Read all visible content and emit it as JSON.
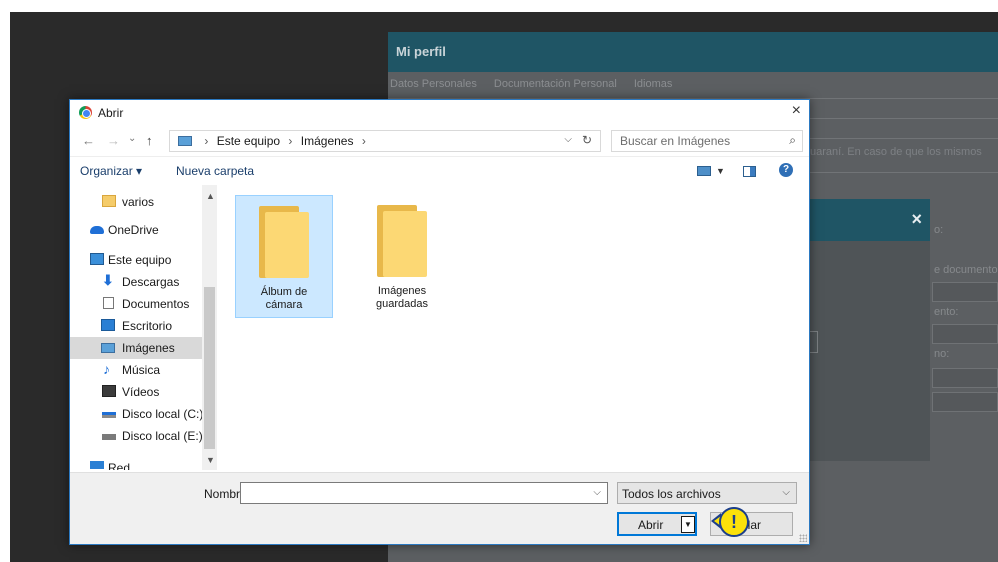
{
  "background_page": {
    "title": "Mi perfil",
    "tabs": [
      "Datos Personales",
      "Documentación Personal",
      "Idiomas"
    ],
    "notice_fragment": "uaraní. En caso de que los mismos",
    "right_labels": [
      "o:",
      "e documento",
      "ento:",
      "no:"
    ],
    "modal_close": "×"
  },
  "dialog": {
    "title": "Abrir",
    "close": "×",
    "nav": {
      "back": "←",
      "forward": "→",
      "recent": "⌄",
      "up": "↑"
    },
    "breadcrumb": [
      "Este equipo",
      "Imágenes"
    ],
    "search_placeholder": "Buscar en Imágenes",
    "toolbar": {
      "organize": "Organizar ▾",
      "new_folder": "Nueva carpeta",
      "help": "?"
    },
    "sidebar": [
      {
        "label": "varios",
        "icon": "folder-icon"
      },
      {
        "label": "OneDrive",
        "icon": "onedrive-icon"
      },
      {
        "label": "Este equipo",
        "icon": "computer-icon"
      },
      {
        "label": "Descargas",
        "icon": "download-icon"
      },
      {
        "label": "Documentos",
        "icon": "documents-icon"
      },
      {
        "label": "Escritorio",
        "icon": "desktop-icon"
      },
      {
        "label": "Imágenes",
        "icon": "pictures-icon",
        "selected": true
      },
      {
        "label": "Música",
        "icon": "music-icon"
      },
      {
        "label": "Vídeos",
        "icon": "videos-icon"
      },
      {
        "label": "Disco local (C:)",
        "icon": "drive-icon"
      },
      {
        "label": "Disco local (E:)",
        "icon": "drive-icon"
      },
      {
        "label": "Red",
        "icon": "network-icon"
      }
    ],
    "files": [
      {
        "name_line1": "Álbum de",
        "name_line2": "cámara",
        "selected": true
      },
      {
        "name_line1": "Imágenes",
        "name_line2": "guardadas",
        "selected": false
      }
    ],
    "filename_label": "Nombre:",
    "filename_value": "",
    "filetype": "Todos los archivos",
    "open_button": "Abrir",
    "cancel_button": "elar"
  },
  "callout": {
    "symbol": "!",
    "color": "#fbe10a"
  }
}
